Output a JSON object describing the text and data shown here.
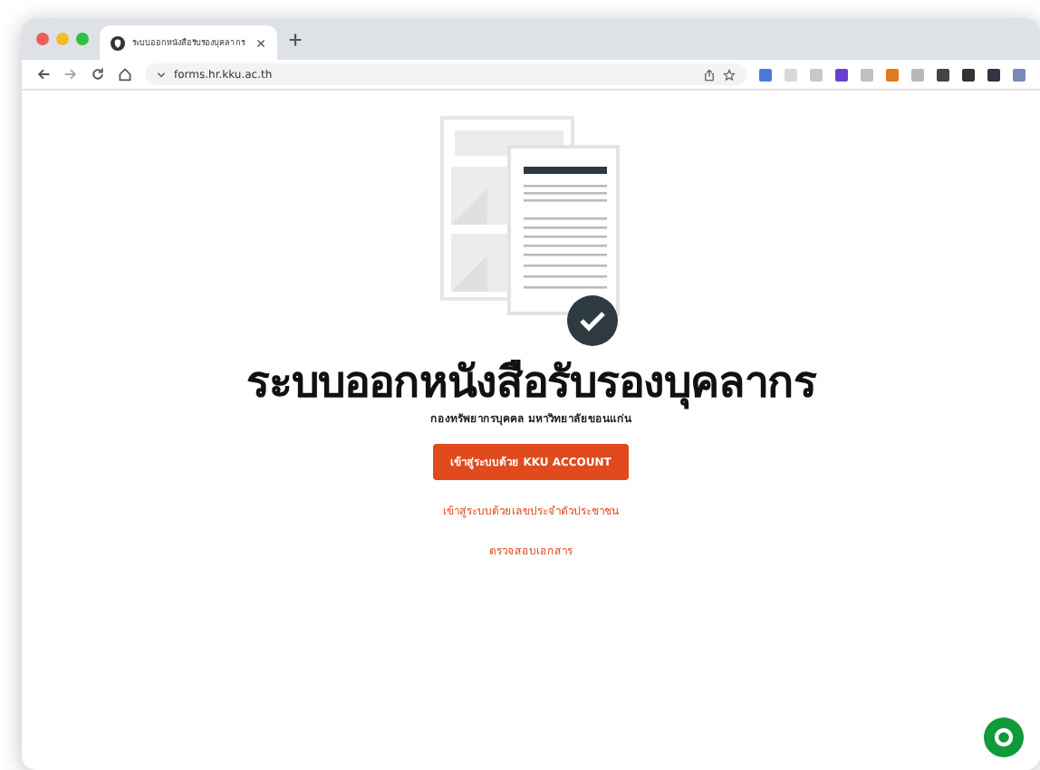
{
  "browser": {
    "tab": {
      "title": "ระบบออกหนังสือรับรองบุคลากร",
      "selected": true
    },
    "address": "forms.hr.kku.ac.th"
  },
  "page": {
    "title": "ระบบออกหนังสือรับรองบุคลากร",
    "subtitle": "กองทรัพยากรบุคคล มหาวิทยาลัยขอนแก่น",
    "login_button": "เข้าสู่ระบบด้วย KKU ACCOUNT",
    "links": [
      "เข้าสู่ระบบด้วยเลขประจำตัวประชาชน",
      "ตรวจสอบเอกสาร"
    ]
  }
}
